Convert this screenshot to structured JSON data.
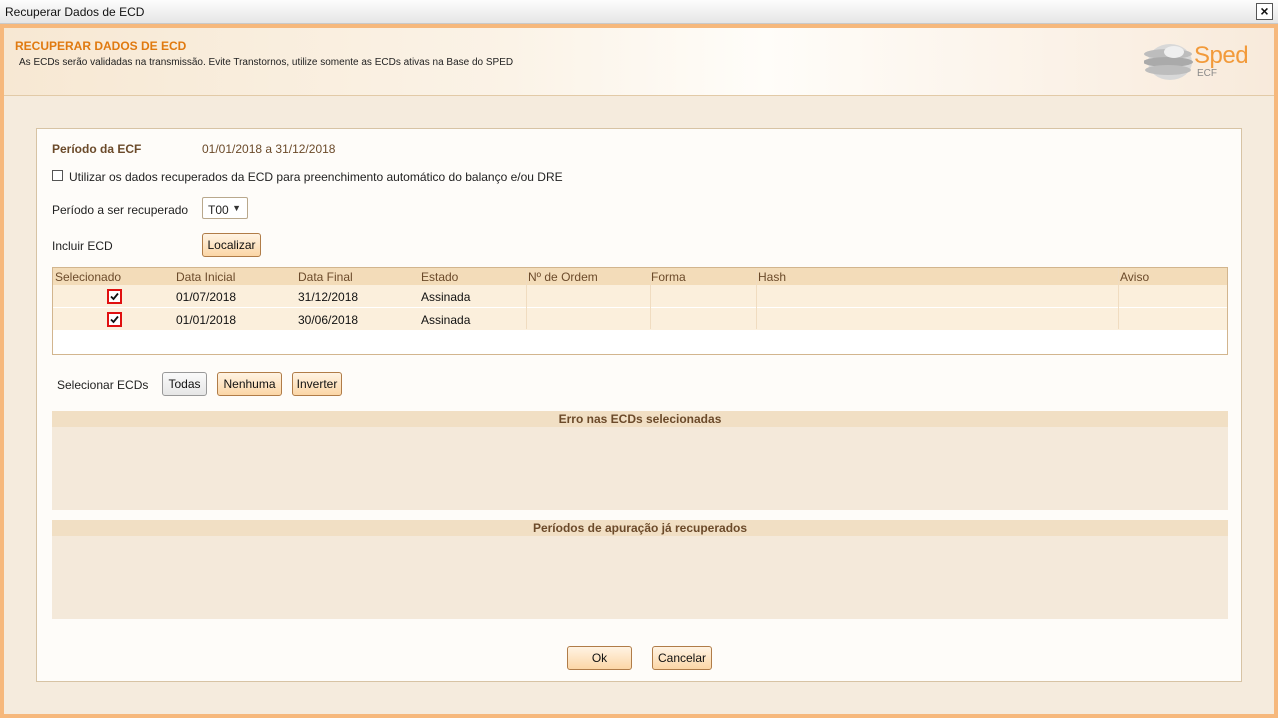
{
  "window": {
    "title": "Recuperar Dados de ECD",
    "close_label": "×"
  },
  "header": {
    "title": "RECUPERAR DADOS DE ECD",
    "subtitle": "As ECDs serão validadas na transmissão. Evite Transtornos, utilize somente as ECDs ativas na Base do SPED",
    "logo_text": "Sped",
    "logo_sub": "ECF"
  },
  "form": {
    "periodo_label": "Período da ECF",
    "periodo_value": "01/01/2018 a 31/12/2018",
    "checkbox_label": "Utilizar os dados recuperados da ECD para preenchimento automático do balanço e/ou DRE",
    "checkbox_checked": false,
    "periodo_recuperar_label": "Período a ser recuperado",
    "periodo_recuperar_value": "T00",
    "incluir_label": "Incluir ECD",
    "localizar_label": "Localizar"
  },
  "table": {
    "columns": [
      "Selecionado",
      "Data Inicial",
      "Data Final",
      "Estado",
      "Nº de Ordem",
      "Forma",
      "Hash",
      "Aviso"
    ],
    "rows": [
      {
        "selected": true,
        "data_inicial": "01/07/2018",
        "data_final": "31/12/2018",
        "estado": "Assinada",
        "ordem": "",
        "forma": "",
        "hash": "",
        "aviso": ""
      },
      {
        "selected": true,
        "data_inicial": "01/01/2018",
        "data_final": "30/06/2018",
        "estado": "Assinada",
        "ordem": "",
        "forma": "",
        "hash": "",
        "aviso": ""
      }
    ]
  },
  "selection": {
    "label": "Selecionar ECDs",
    "todas": "Todas",
    "nenhuma": "Nenhuma",
    "inverter": "Inverter"
  },
  "panels": {
    "erros_title": "Erro nas ECDs selecionadas",
    "periodos_title": "Períodos de apuração já recuperados"
  },
  "footer": {
    "ok": "Ok",
    "cancelar": "Cancelar"
  }
}
